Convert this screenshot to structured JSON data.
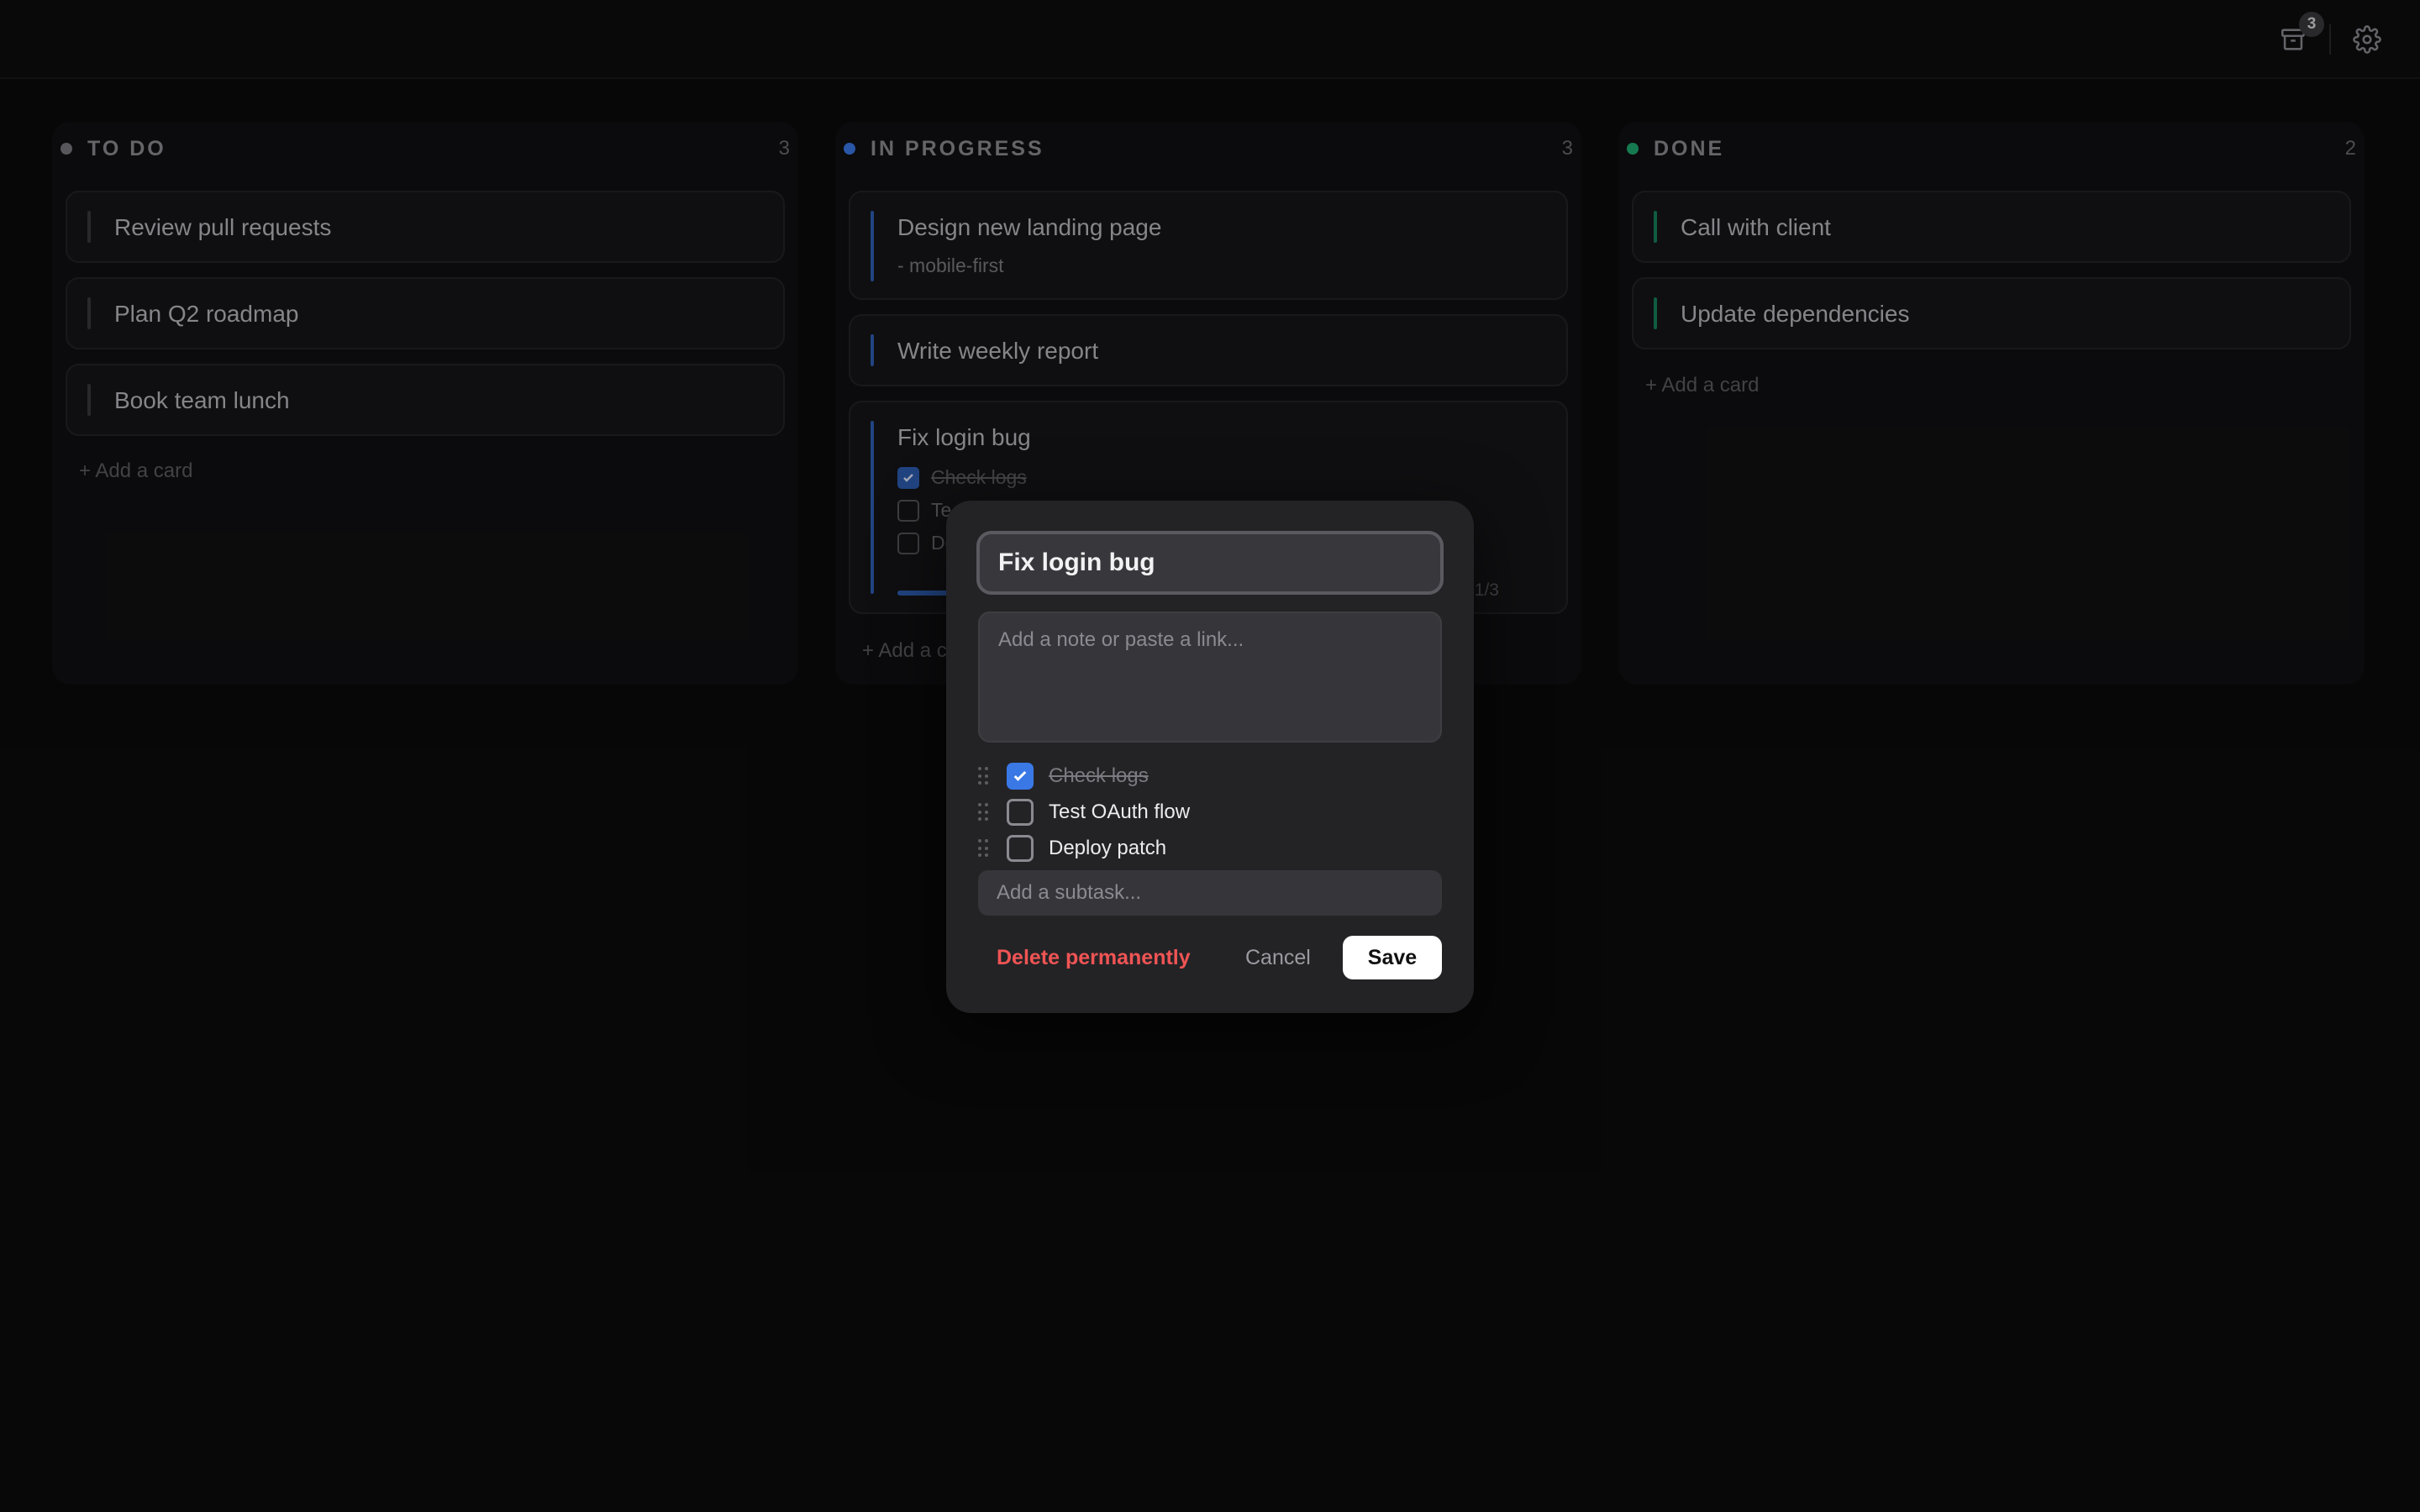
{
  "topbar": {
    "archive_badge": "3"
  },
  "colors": {
    "todo": "#7a7a80",
    "in_progress": "#3a78e6",
    "done": "#1fa971",
    "danger": "#f05454"
  },
  "columns": [
    {
      "title": "TO DO",
      "count": "3",
      "cards": [
        {
          "title": "Review pull requests"
        },
        {
          "title": "Plan Q2 roadmap"
        },
        {
          "title": "Book team lunch"
        }
      ],
      "add_label": "+ Add a card"
    },
    {
      "title": "IN PROGRESS",
      "count": "3",
      "cards": [
        {
          "title": "Design new landing page",
          "note": "- mobile-first"
        },
        {
          "title": "Write weekly report"
        },
        {
          "title": "Fix login bug",
          "subtasks": [
            {
              "label": "Check logs",
              "done": true
            },
            {
              "label": "Te",
              "done": false
            },
            {
              "label": "De",
              "done": false
            }
          ],
          "progress": 0.333,
          "progress_label": "1/3"
        }
      ],
      "add_label": "+ Add a c"
    },
    {
      "title": "DONE",
      "count": "2",
      "cards": [
        {
          "title": "Call with client"
        },
        {
          "title": "Update dependencies"
        }
      ],
      "add_label": "+ Add a card"
    }
  ],
  "modal": {
    "title_value": "Fix login bug",
    "note_placeholder": "Add a note or paste a link...",
    "subtasks": [
      {
        "label": "Check logs",
        "done": true
      },
      {
        "label": "Test OAuth flow",
        "done": false
      },
      {
        "label": "Deploy patch",
        "done": false
      }
    ],
    "subtask_placeholder": "Add a subtask...",
    "delete_label": "Delete permanently",
    "cancel_label": "Cancel",
    "save_label": "Save"
  }
}
